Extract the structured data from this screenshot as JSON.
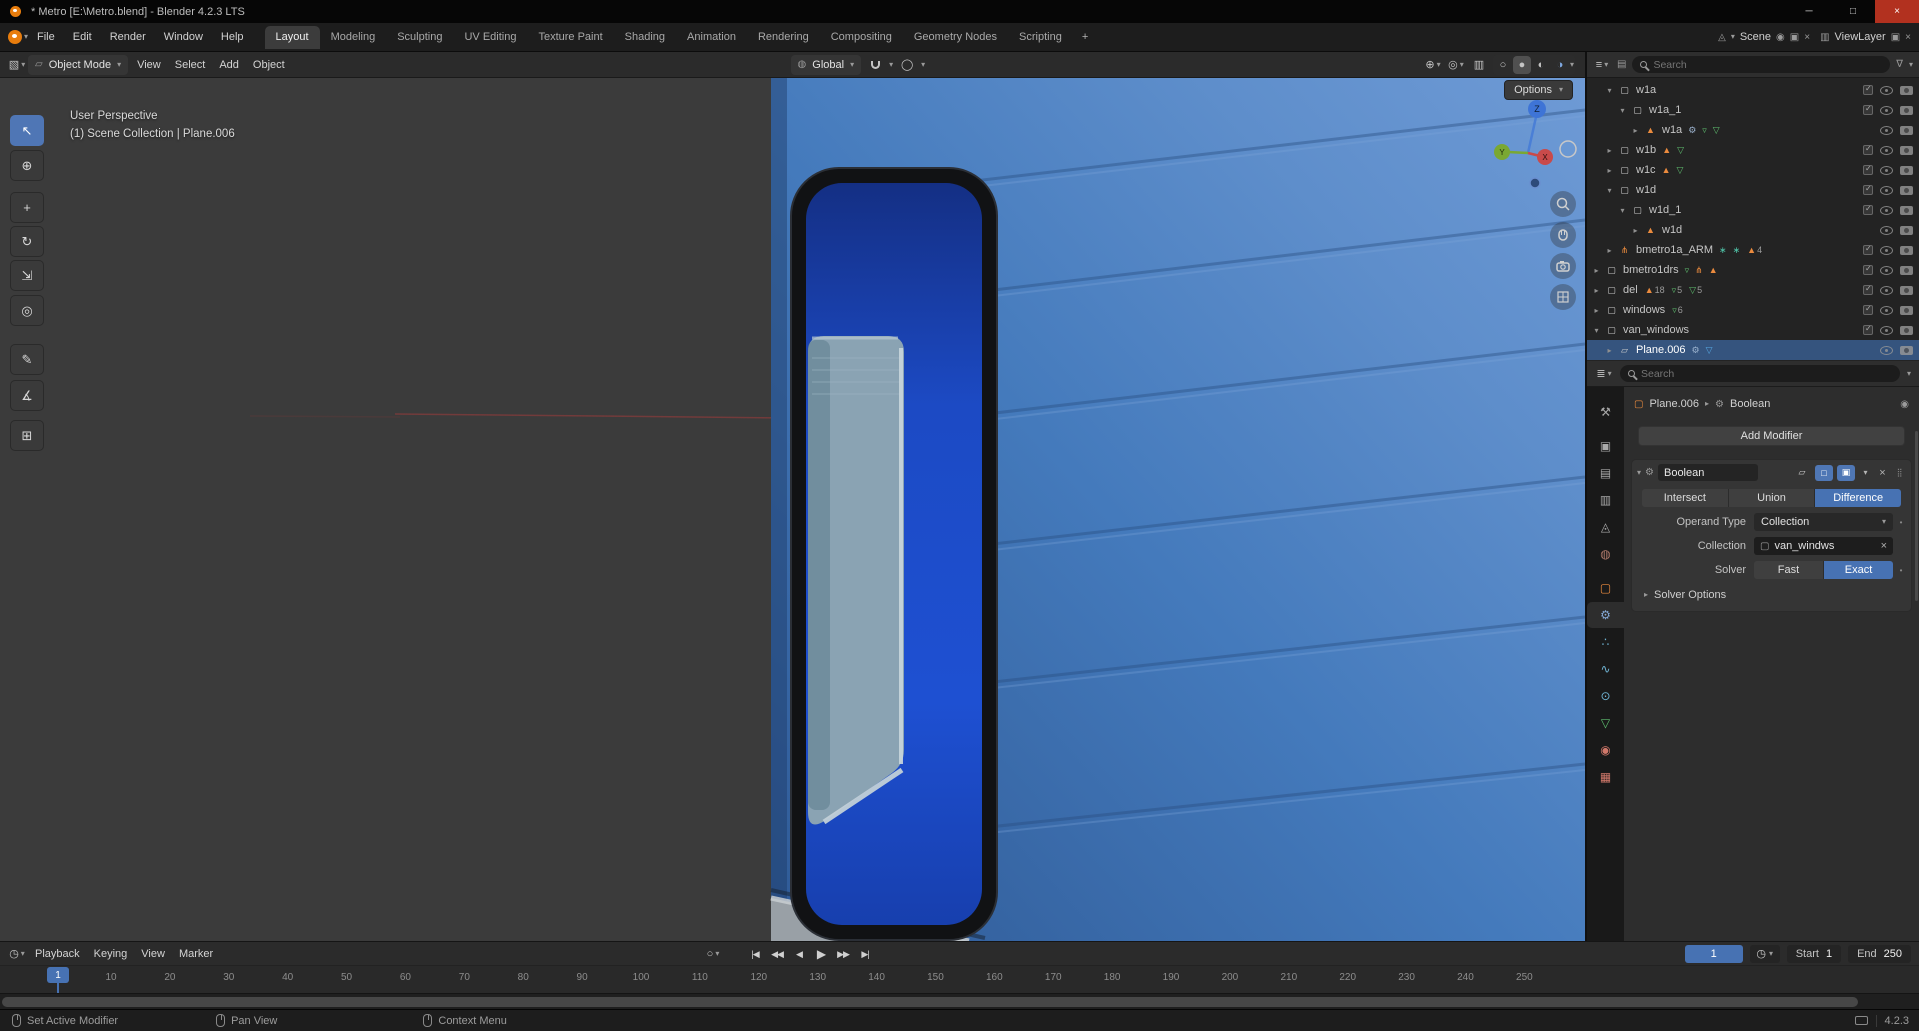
{
  "colors": {
    "accent": "#4772b3",
    "mesh_orange": "#eb8b3e",
    "data_green": "#5fbf6f",
    "data_blue": "#56a7e0"
  },
  "icons": {
    "chevron_down": "▾",
    "chevron_right": "▸",
    "close": "×",
    "minimize": "─",
    "maximize": "□",
    "editor_viewport": "▧",
    "editor_outliner": "≡",
    "editor_properties": "≣",
    "editor_timeline": "◷",
    "globe": "◍",
    "proportional": "◯",
    "overlays": "◎",
    "gizmo": "⊕",
    "xray": "▥",
    "wireframe": "○",
    "solid": "●",
    "material_preview": "◐",
    "rendered": "◑",
    "pin": "◉",
    "new": "▣",
    "display_mode": "▤",
    "filter": "∇",
    "stopwatch": "◷",
    "autokey": "○",
    "scene": "◬",
    "viewlayer": "▥",
    "object_mode": "▱",
    "drag": "⣿",
    "gear": "⚙",
    "object": "▢"
  },
  "titlebar": {
    "title": "* Metro [E:\\Metro.blend] - Blender 4.2.3 LTS"
  },
  "topbar": {
    "menus": [
      "File",
      "Edit",
      "Render",
      "Window",
      "Help"
    ],
    "workspaces": [
      "Layout",
      "Modeling",
      "Sculpting",
      "UV Editing",
      "Texture Paint",
      "Shading",
      "Animation",
      "Rendering",
      "Compositing",
      "Geometry Nodes",
      "Scripting"
    ],
    "active_workspace": "Layout",
    "add_workspace": "+",
    "scene_label": "Scene",
    "viewlayer_label": "ViewLayer"
  },
  "viewport_header": {
    "mode": "Object Mode",
    "menus": [
      "View",
      "Select",
      "Add",
      "Object"
    ],
    "orientation": "Global",
    "options_label": "Options"
  },
  "viewport": {
    "perspective_label": "User Perspective",
    "context_label": "(1) Scene Collection | Plane.006"
  },
  "toolbar": [
    {
      "name": "tweak-select",
      "glyph": "↖",
      "active": true
    },
    {
      "name": "cursor",
      "glyph": "⊕"
    },
    {
      "name": "move",
      "glyph": "+"
    },
    {
      "name": "rotate",
      "glyph": "↻"
    },
    {
      "name": "scale",
      "glyph": "⇲"
    },
    {
      "name": "transform",
      "glyph": "◎"
    },
    {
      "name": "annotate",
      "glyph": "✎"
    },
    {
      "name": "measure",
      "glyph": "∡"
    },
    {
      "name": "add-cube",
      "glyph": "⊞"
    }
  ],
  "outliner": {
    "search_placeholder": "Search",
    "icon_meta": {
      "collection": {
        "g": "▢",
        "c": "#c8c8c8"
      },
      "mesh": {
        "g": "▲",
        "c": "#eb8b3e"
      },
      "plane": {
        "g": "▱",
        "c": "#cfcfcf"
      },
      "armature": {
        "g": "⋔",
        "c": "#eb8b3e"
      },
      "modifier": {
        "g": "⚙",
        "c": "#9db4d0"
      },
      "vgroup": {
        "g": "▿",
        "c": "#5fbf6f"
      },
      "pose": {
        "g": "∗",
        "c": "#4fc1a6"
      },
      "data_blue": {
        "g": "▽",
        "c": "#56a7e0"
      },
      "data_green": {
        "g": "▽",
        "c": "#5fbf6f"
      }
    },
    "items": [
      {
        "label": "w1a",
        "depth": 1,
        "chevron": "down",
        "icon": "collection",
        "right": [
          "check",
          "eye",
          "camera"
        ]
      },
      {
        "label": "w1a_1",
        "depth": 2,
        "chevron": "down",
        "icon": "collection",
        "right": [
          "check",
          "eye",
          "camera"
        ]
      },
      {
        "label": "w1a",
        "depth": 3,
        "chevron": "right",
        "icon": "mesh",
        "extras": [
          "modifier",
          "vgroup",
          "data_green"
        ],
        "right": [
          "eye",
          "camera"
        ]
      },
      {
        "label": "w1b",
        "depth": 1,
        "chevron": "right",
        "icon": "collection",
        "extras": [
          "mesh",
          "data_green"
        ],
        "right": [
          "check",
          "eye",
          "camera"
        ]
      },
      {
        "label": "w1c",
        "depth": 1,
        "chevron": "right",
        "icon": "collection",
        "extras": [
          "mesh",
          "data_green"
        ],
        "right": [
          "check",
          "eye",
          "camera"
        ]
      },
      {
        "label": "w1d",
        "depth": 1,
        "chevron": "down",
        "icon": "collection",
        "right": [
          "check",
          "eye",
          "camera"
        ]
      },
      {
        "label": "w1d_1",
        "depth": 2,
        "chevron": "down",
        "icon": "collection",
        "right": [
          "check",
          "eye",
          "camera"
        ]
      },
      {
        "label": "w1d",
        "depth": 3,
        "chevron": "right",
        "icon": "mesh",
        "right": [
          "eye",
          "camera"
        ]
      },
      {
        "label": "bmetro1a_ARM",
        "depth": 1,
        "chevron": "right",
        "icon": "armature",
        "extras": [
          "pose",
          "pose"
        ],
        "badges": [
          {
            "icon": "mesh",
            "count": "4"
          }
        ],
        "right": [
          "check",
          "eye",
          "camera"
        ]
      },
      {
        "label": "bmetro1drs",
        "depth": 0,
        "chevron": "right",
        "icon": "collection",
        "extras": [
          "vgroup",
          "armature",
          "mesh"
        ],
        "right": [
          "check",
          "eye",
          "camera"
        ]
      },
      {
        "label": "del",
        "depth": 0,
        "chevron": "right",
        "icon": "collection",
        "badges": [
          {
            "icon": "mesh",
            "count": "18"
          },
          {
            "icon": "vgroup",
            "count": "5"
          },
          {
            "icon": "data_green",
            "count": "5"
          }
        ],
        "right": [
          "check",
          "eye",
          "camera"
        ]
      },
      {
        "label": "windows",
        "depth": 0,
        "chevron": "right",
        "icon": "collection",
        "badges": [
          {
            "icon": "vgroup",
            "count": "6"
          }
        ],
        "right": [
          "check",
          "eye",
          "camera"
        ]
      },
      {
        "label": "van_windows",
        "depth": 0,
        "chevron": "down",
        "icon": "collection",
        "right": [
          "check",
          "eye",
          "camera"
        ]
      },
      {
        "label": "Plane.006",
        "depth": 1,
        "chevron": "right",
        "icon": "plane",
        "selected": true,
        "extras": [
          "modifier",
          "data_blue"
        ],
        "right": [
          "eye",
          "camera"
        ]
      }
    ]
  },
  "properties": {
    "search_placeholder": "Search",
    "breadcrumb": {
      "object": "Plane.006",
      "modifier": "Boolean"
    },
    "add_modifier_label": "Add Modifier",
    "tabs": [
      "tool",
      "render",
      "output",
      "view-layer",
      "scene",
      "world",
      "object",
      "modifiers",
      "particles",
      "physics",
      "constraints",
      "object-data",
      "material",
      "texture"
    ],
    "active_tab": "modifiers",
    "tab_meta": {
      "tool": {
        "g": "⚒",
        "c": "#a8a8a8"
      },
      "render": {
        "g": "▣",
        "c": "#a8a8a8"
      },
      "output": {
        "g": "▤",
        "c": "#a8a8a8"
      },
      "view-layer": {
        "g": "▥",
        "c": "#a8a8a8"
      },
      "scene": {
        "g": "◬",
        "c": "#a8a8a8"
      },
      "world": {
        "g": "◍",
        "c": "#b07a6a"
      },
      "object": {
        "g": "▢",
        "c": "#eb8b3e"
      },
      "modifiers": {
        "g": "⚙",
        "c": "#85a9d6"
      },
      "particles": {
        "g": "∴",
        "c": "#6fb3d2"
      },
      "physics": {
        "g": "∿",
        "c": "#6fb3d2"
      },
      "constraints": {
        "g": "⊙",
        "c": "#6fb3d2"
      },
      "object-data": {
        "g": "▽",
        "c": "#5fbf6f"
      },
      "material": {
        "g": "◉",
        "c": "#d0786a"
      },
      "texture": {
        "g": "▦",
        "c": "#d0786a"
      }
    },
    "modifier": {
      "name": "Boolean",
      "operations": [
        "Intersect",
        "Union",
        "Difference"
      ],
      "active_operation": "Difference",
      "operand_type_label": "Operand Type",
      "operand_type_value": "Collection",
      "collection_label": "Collection",
      "collection_value": "van_windws",
      "solver_label": "Solver",
      "solver_modes": [
        "Fast",
        "Exact"
      ],
      "active_solver": "Exact",
      "solver_options_label": "Solver Options"
    }
  },
  "timeline": {
    "menus": [
      "Playback",
      "Keying",
      "View",
      "Marker"
    ],
    "playback": [
      {
        "name": "jump-to-start",
        "glyph": "|◀"
      },
      {
        "name": "jump-to-prev-keyframe",
        "glyph": "◀◀"
      },
      {
        "name": "play-reverse",
        "glyph": "◀"
      },
      {
        "name": "play",
        "glyph": "▶"
      },
      {
        "name": "jump-to-next-keyframe",
        "glyph": "▶▶"
      },
      {
        "name": "jump-to-end",
        "glyph": "▶|"
      }
    ],
    "current_frame": "1",
    "start_label": "Start",
    "start_value": "1",
    "end_label": "End",
    "end_value": "250",
    "ruler_ticks": [
      "1",
      "10",
      "20",
      "30",
      "40",
      "50",
      "60",
      "70",
      "80",
      "90",
      "100",
      "110",
      "120",
      "130",
      "140",
      "150",
      "160",
      "170",
      "180",
      "190",
      "200",
      "210",
      "220",
      "230",
      "240",
      "250"
    ]
  },
  "statusbar": {
    "items": [
      {
        "label": "Set Active Modifier"
      },
      {
        "label": "Pan View"
      },
      {
        "label": "Context Menu"
      }
    ],
    "version": "4.2.3"
  }
}
